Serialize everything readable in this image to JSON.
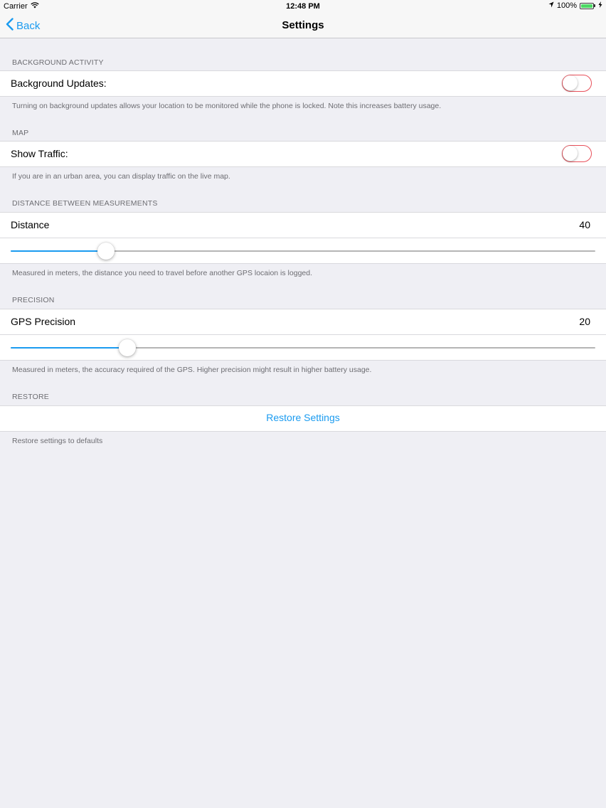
{
  "status_bar": {
    "carrier": "Carrier",
    "time": "12:48 PM",
    "battery": "100%",
    "battery_level": 1.0
  },
  "nav": {
    "back_label": "Back",
    "title": "Settings"
  },
  "background_activity": {
    "header": "BACKGROUND ACTIVITY",
    "label": "Background Updates:",
    "toggle_on": false,
    "footer": "Turning on background updates allows your location to be monitored while the phone is locked. Note this increases battery usage."
  },
  "map": {
    "header": "MAP",
    "label": "Show Traffic:",
    "toggle_on": false,
    "footer": "If you are in an urban area, you can display traffic on the live map."
  },
  "distance": {
    "header": "DISTANCE BETWEEN MEASUREMENTS",
    "label": "Distance",
    "value": "40",
    "slider_fraction": 0.163,
    "footer": "Measured in meters, the distance you need to travel before another GPS locaion is logged."
  },
  "precision": {
    "header": "PRECISION",
    "label": "GPS Precision",
    "value": "20",
    "slider_fraction": 0.199,
    "footer": "Measured in meters, the accuracy required of the GPS. Higher precision might result in higher battery usage."
  },
  "restore": {
    "header": "RESTORE",
    "button_label": "Restore Settings",
    "footer": "Restore settings to defaults"
  },
  "colors": {
    "accent": "#1a9bf0",
    "toggle_off_border": "#e8505a",
    "background": "#efeff4"
  }
}
